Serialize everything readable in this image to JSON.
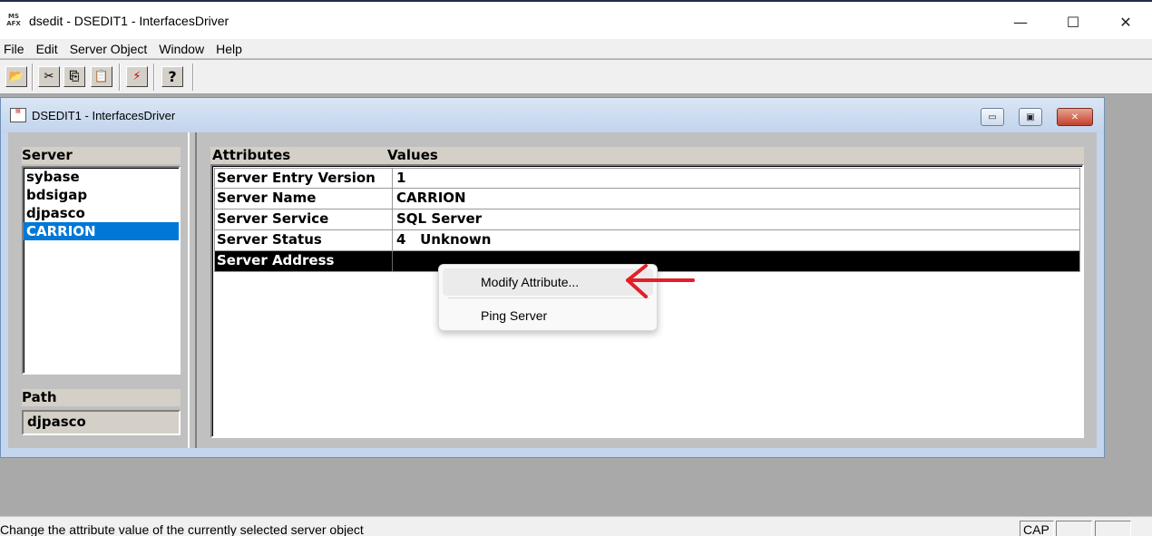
{
  "app": {
    "icon_text": "MS AFX",
    "title": "dsedit - DSEDIT1 - InterfacesDriver",
    "controls": {
      "minimize": "—",
      "maximize": "☐",
      "close": "✕"
    }
  },
  "menu": [
    "File",
    "Edit",
    "Server Object",
    "Window",
    "Help"
  ],
  "toolbar": {
    "buttons": [
      {
        "name": "open",
        "glyph": "📂"
      },
      {
        "name": "cut",
        "glyph": "✂"
      },
      {
        "name": "copy",
        "glyph": "⎘"
      },
      {
        "name": "paste",
        "glyph": "📋"
      },
      {
        "name": "ping",
        "glyph": "⚡"
      },
      {
        "name": "help",
        "glyph": "?"
      }
    ]
  },
  "child": {
    "title": "DSEDIT1 - InterfacesDriver",
    "controls": {
      "minimize": "▭",
      "restore": "▣",
      "close": "✕"
    }
  },
  "server_pane": {
    "header": "Server",
    "servers": [
      "sybase",
      "bdsigap",
      "djpasco",
      "CARRION"
    ],
    "selected_index": 3,
    "path_label": "Path",
    "path_value": "djpasco"
  },
  "attributes": {
    "header_attr": "Attributes",
    "header_val": "Values",
    "rows": [
      {
        "attr": "Server Entry Version",
        "value": "1"
      },
      {
        "attr": "Server Name",
        "value": "CARRION"
      },
      {
        "attr": "Server Service",
        "value": "SQL Server"
      },
      {
        "attr": "Server Status",
        "value": "4   Unknown"
      },
      {
        "attr": "Server Address",
        "value": ""
      }
    ],
    "selected_index": 4
  },
  "context_menu": {
    "items": [
      "Modify Attribute...",
      "Ping Server"
    ],
    "highlighted_index": 0,
    "annotation_arrow_color": "#e0202a"
  },
  "status": {
    "text": "Change the attribute value of the currently selected server object",
    "indicators": [
      "CAP",
      "",
      ""
    ]
  }
}
